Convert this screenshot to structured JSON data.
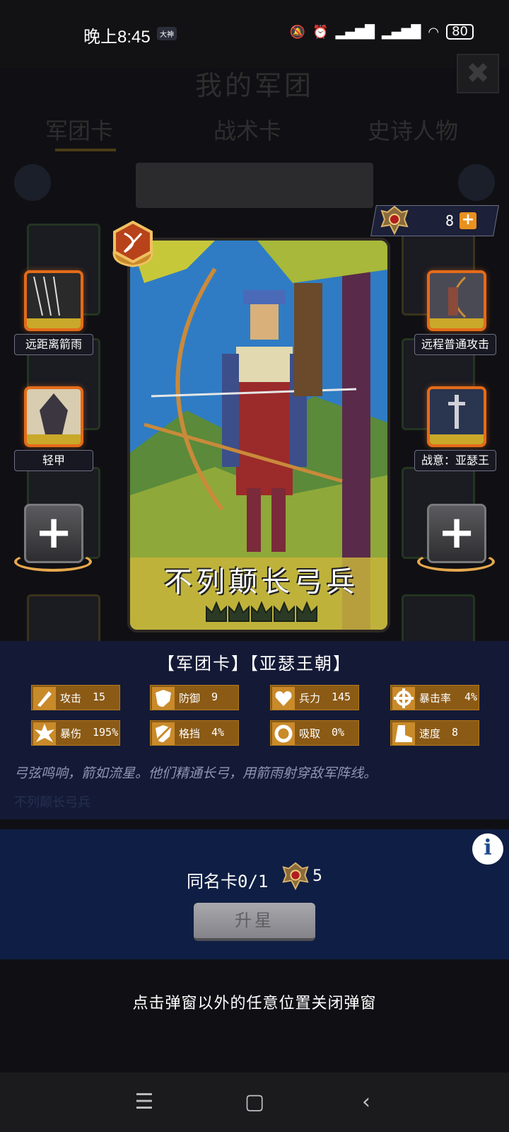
{
  "status": {
    "time": "晚上8:45",
    "badge": "大神",
    "battery": "80"
  },
  "background": {
    "title": "我的军团",
    "tabs": [
      "军团卡",
      "战术卡",
      "史诗人物"
    ]
  },
  "currency": {
    "value": "8"
  },
  "card": {
    "name": "不列颠长弓兵",
    "stars": 5
  },
  "skills_left": [
    {
      "label": "远距离箭雨"
    },
    {
      "label": "轻甲"
    }
  ],
  "skills_right": [
    {
      "label": "远程普通攻击"
    },
    {
      "label": "战意：亚瑟王"
    }
  ],
  "info": {
    "type_line": "【军团卡】【亚瑟王朝】",
    "stats": [
      {
        "name": "攻击",
        "value": "15",
        "icon": "sword-icon"
      },
      {
        "name": "防御",
        "value": "9",
        "icon": "shield-icon"
      },
      {
        "name": "兵力",
        "value": "145",
        "icon": "heart-icon"
      },
      {
        "name": "暴击率",
        "value": "4%",
        "icon": "crosshair-icon"
      },
      {
        "name": "暴伤",
        "value": "195%",
        "icon": "burst-icon"
      },
      {
        "name": "格挡",
        "value": "4%",
        "icon": "block-icon"
      },
      {
        "name": "吸取",
        "value": "0%",
        "icon": "drain-icon"
      },
      {
        "name": "速度",
        "value": "8",
        "icon": "boot-icon"
      }
    ],
    "description": "弓弦鸣响，箭如流星。他们精通长弓，用箭雨射穿敌军阵线。",
    "ghost_name": "不列颠长弓兵"
  },
  "lower": {
    "dup_label": "同名卡0/1",
    "dup_count": "5",
    "upgrade_label": "升星"
  },
  "close_hint": "点击弹窗以外的任意位置关闭弹窗"
}
